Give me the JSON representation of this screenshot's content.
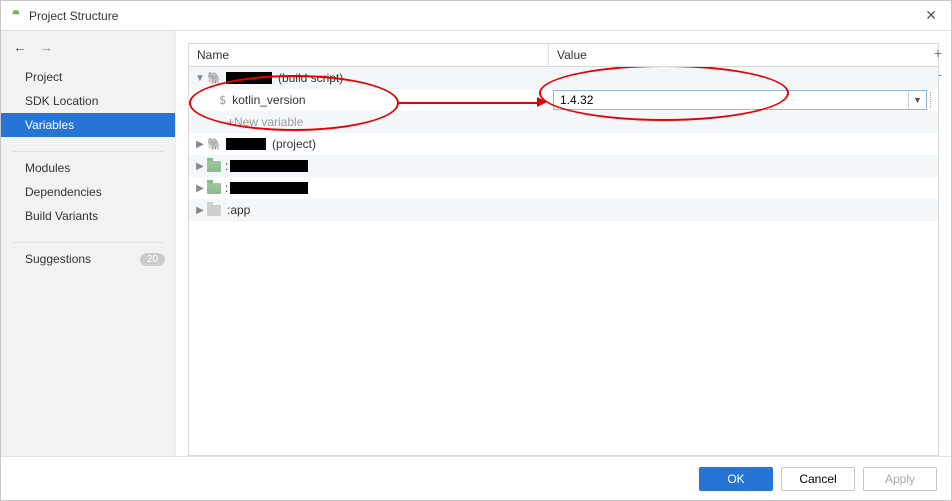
{
  "window": {
    "title": "Project Structure"
  },
  "sidebar": {
    "items": [
      {
        "label": "Project"
      },
      {
        "label": "SDK Location"
      },
      {
        "label": "Variables",
        "selected": true
      },
      {
        "label": "Modules"
      },
      {
        "label": "Dependencies"
      },
      {
        "label": "Build Variants"
      },
      {
        "label": "Suggestions",
        "badge": "20"
      }
    ]
  },
  "columns": {
    "name": "Name",
    "value": "Value"
  },
  "tree": {
    "build_script_suffix": "(build script)",
    "variable_name": "kotlin_version",
    "variable_value": "1.4.32",
    "new_variable": "+New variable",
    "project_suffix": "(project)",
    "app_label": ":app"
  },
  "buttons": {
    "ok": "OK",
    "cancel": "Cancel",
    "apply": "Apply"
  }
}
